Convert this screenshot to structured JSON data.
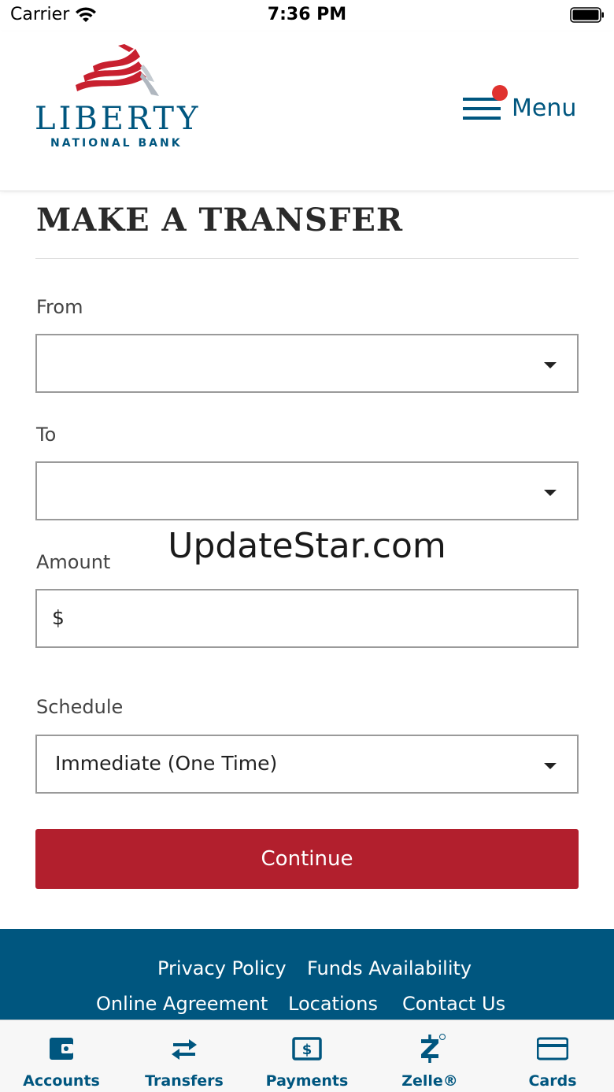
{
  "status_bar": {
    "carrier": "Carrier",
    "time": "7:36 PM"
  },
  "header": {
    "logo_name": "LIBERTY",
    "logo_sub": "NATIONAL BANK",
    "menu_label": "Menu",
    "brand_color": "#00567f",
    "flag_red": "#c8202f"
  },
  "page": {
    "title": "MAKE A TRANSFER"
  },
  "form": {
    "from_label": "From",
    "from_value": "",
    "to_label": "To",
    "to_value": "",
    "amount_label": "Amount",
    "currency_symbol": "$",
    "amount_value": "",
    "schedule_label": "Schedule",
    "schedule_value": "Immediate (One Time)",
    "continue_label": "Continue",
    "continue_color": "#b21f2d"
  },
  "watermark": "UpdateStar.com",
  "footer": {
    "links": [
      "Privacy Policy",
      "Funds Availability",
      "Online Agreement",
      "Locations",
      "Contact Us"
    ]
  },
  "tabbar": {
    "tabs": [
      {
        "label": "Accounts",
        "icon": "wallet-icon"
      },
      {
        "label": "Transfers",
        "icon": "transfer-arrows-icon"
      },
      {
        "label": "Payments",
        "icon": "bill-dollar-icon"
      },
      {
        "label": "Zelle®",
        "icon": "zelle-icon"
      },
      {
        "label": "Cards",
        "icon": "credit-card-icon"
      }
    ]
  }
}
